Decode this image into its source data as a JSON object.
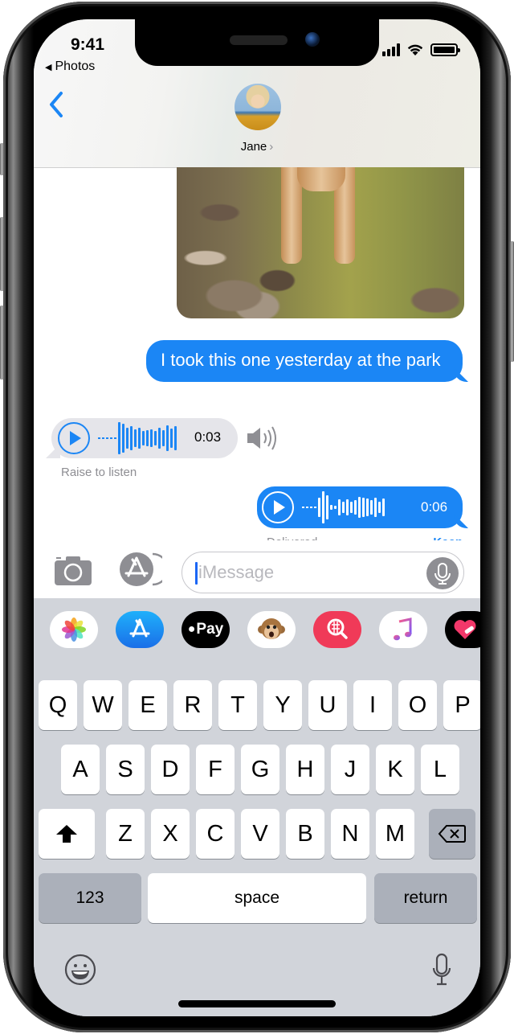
{
  "status_bar": {
    "time": "9:41",
    "back_app": "Photos"
  },
  "header": {
    "contact_name": "Jane",
    "back_label": "Back"
  },
  "messages": {
    "sent_text": "I took this one yesterday at the park",
    "received_audio": {
      "duration": "0:03",
      "hint": "Raise to listen"
    },
    "sent_audio": {
      "duration": "0:06",
      "status": "Delivered",
      "keep_label": "Keep"
    }
  },
  "compose": {
    "placeholder": "iMessage"
  },
  "app_drawer": {
    "apps": [
      {
        "name": "Photos",
        "icon": "photos-icon"
      },
      {
        "name": "App Store",
        "icon": "app-store-icon"
      },
      {
        "name": "Apple Pay",
        "icon": "apple-pay-icon",
        "label": "Pay"
      },
      {
        "name": "Animoji",
        "icon": "animoji-monkey-icon"
      },
      {
        "name": "Search Images",
        "icon": "image-search-icon"
      },
      {
        "name": "Music",
        "icon": "music-icon"
      },
      {
        "name": "Digital Touch",
        "icon": "digital-touch-icon"
      }
    ]
  },
  "keyboard": {
    "row1": [
      "Q",
      "W",
      "E",
      "R",
      "T",
      "Y",
      "U",
      "I",
      "O",
      "P"
    ],
    "row2": [
      "A",
      "S",
      "D",
      "F",
      "G",
      "H",
      "J",
      "K",
      "L"
    ],
    "row3": [
      "Z",
      "X",
      "C",
      "V",
      "B",
      "N",
      "M"
    ],
    "numbers_label": "123",
    "space_label": "space",
    "return_label": "return"
  },
  "colors": {
    "accent": "#1b86f5",
    "received_bubble": "#e5e5ea",
    "keyboard_bg": "#d1d4da"
  }
}
